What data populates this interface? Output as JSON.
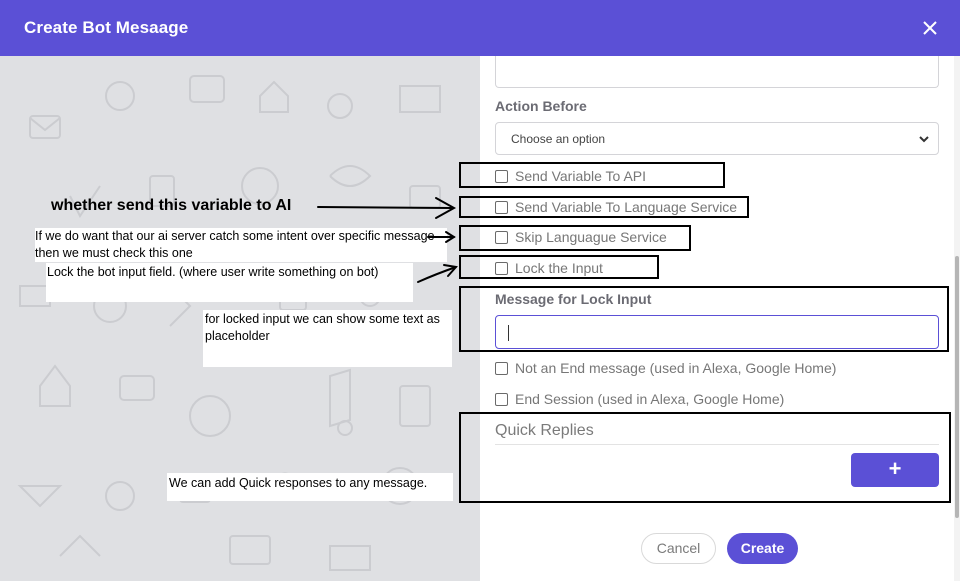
{
  "header": {
    "title": "Create Bot Mesaage"
  },
  "form": {
    "action_before_label": "Action Before",
    "action_before_select": "Choose an option",
    "checkboxes": [
      "Send Variable To API",
      "Send Variable To Language Service",
      "Skip Languague Service",
      "Lock the Input"
    ],
    "lock_input_label": "Message for Lock Input",
    "extra_checkboxes": [
      "Not an End message (used in Alexa, Google Home)",
      "End Session (used in Alexa, Google Home)"
    ],
    "quick_replies_title": "Quick Replies",
    "add_button": "+",
    "cancel_button": "Cancel",
    "create_button": "Create"
  },
  "annotations": {
    "send_to_ai": "whether send this variable to AI",
    "skip_language": "If we do want that our ai server catch some intent over specific message then we must check this one",
    "lock_input": "Lock the bot input field. (where user write something on bot)",
    "placeholder": "for locked input we can show some text as placeholder",
    "quick_responses": "We can add Quick responses to any message."
  },
  "colors": {
    "accent": "#5b50d6"
  }
}
